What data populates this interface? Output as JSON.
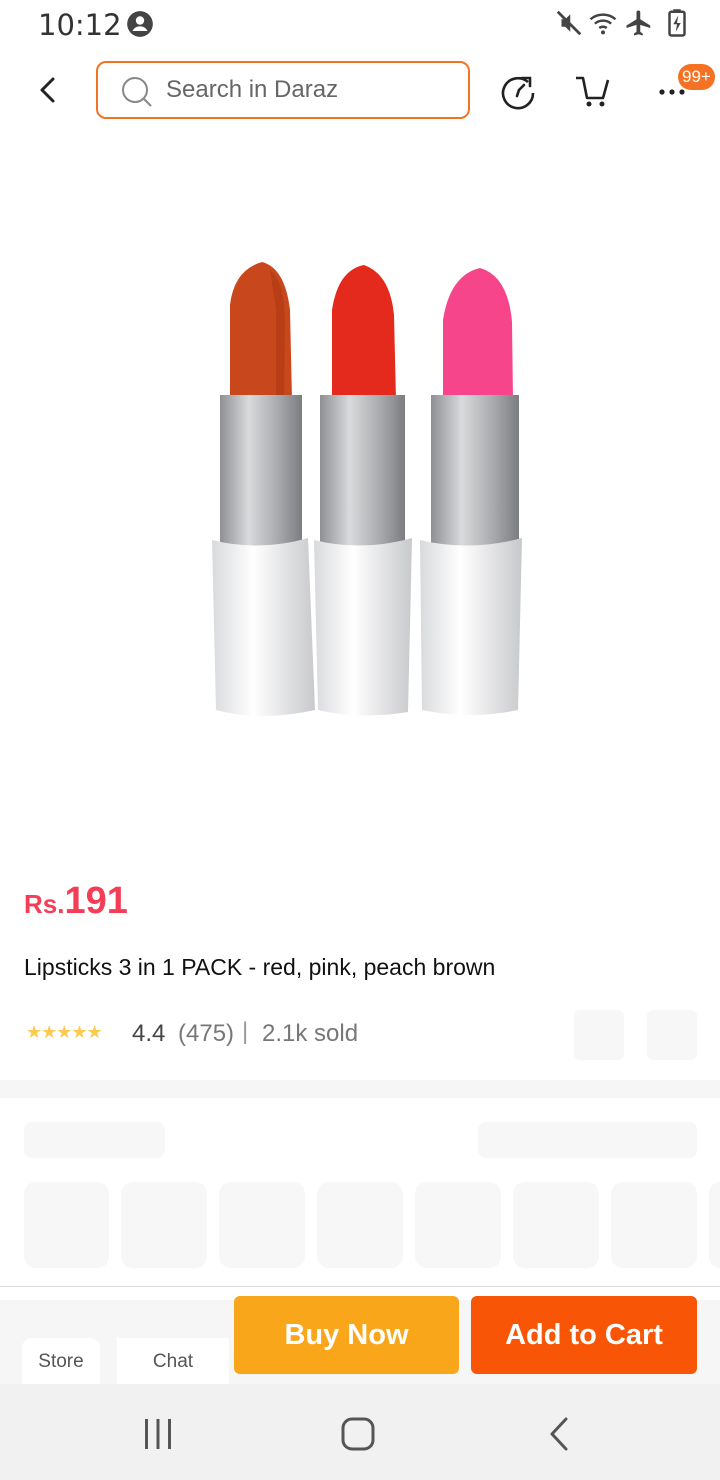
{
  "status_bar": {
    "time": "10:12",
    "icons": [
      "account-circle-icon",
      "mute-icon",
      "wifi-icon",
      "airplane-mode-icon",
      "battery-charging-icon"
    ]
  },
  "header": {
    "search_placeholder": "Search in Daraz",
    "cart_badge": "99+",
    "icons": [
      "back-icon",
      "search-icon",
      "share-icon",
      "cart-icon",
      "more-icon"
    ]
  },
  "product": {
    "price_currency": "Rs.",
    "price_amount": "191",
    "title": "Lipsticks 3 in 1 PACK - red, pink, peach brown",
    "rating_value": "4.4",
    "rating_stars": 4.4,
    "rating_count": "(475)",
    "separator": "|",
    "sold": "2.1k sold",
    "stars_text": "★★★★★",
    "colors": {
      "price": "#f53d57",
      "star": "#faca51"
    }
  },
  "actions": {
    "store_label": "Store",
    "chat_label": "Chat",
    "buy_now_label": "Buy Now",
    "add_to_cart_label": "Add to Cart",
    "colors": {
      "buy_now": "#faa61a",
      "add_to_cart": "#f85606",
      "accent": "#f57224"
    }
  },
  "nav_bar": {
    "icons": [
      "recent-apps-icon",
      "home-icon",
      "nav-back-icon"
    ]
  }
}
